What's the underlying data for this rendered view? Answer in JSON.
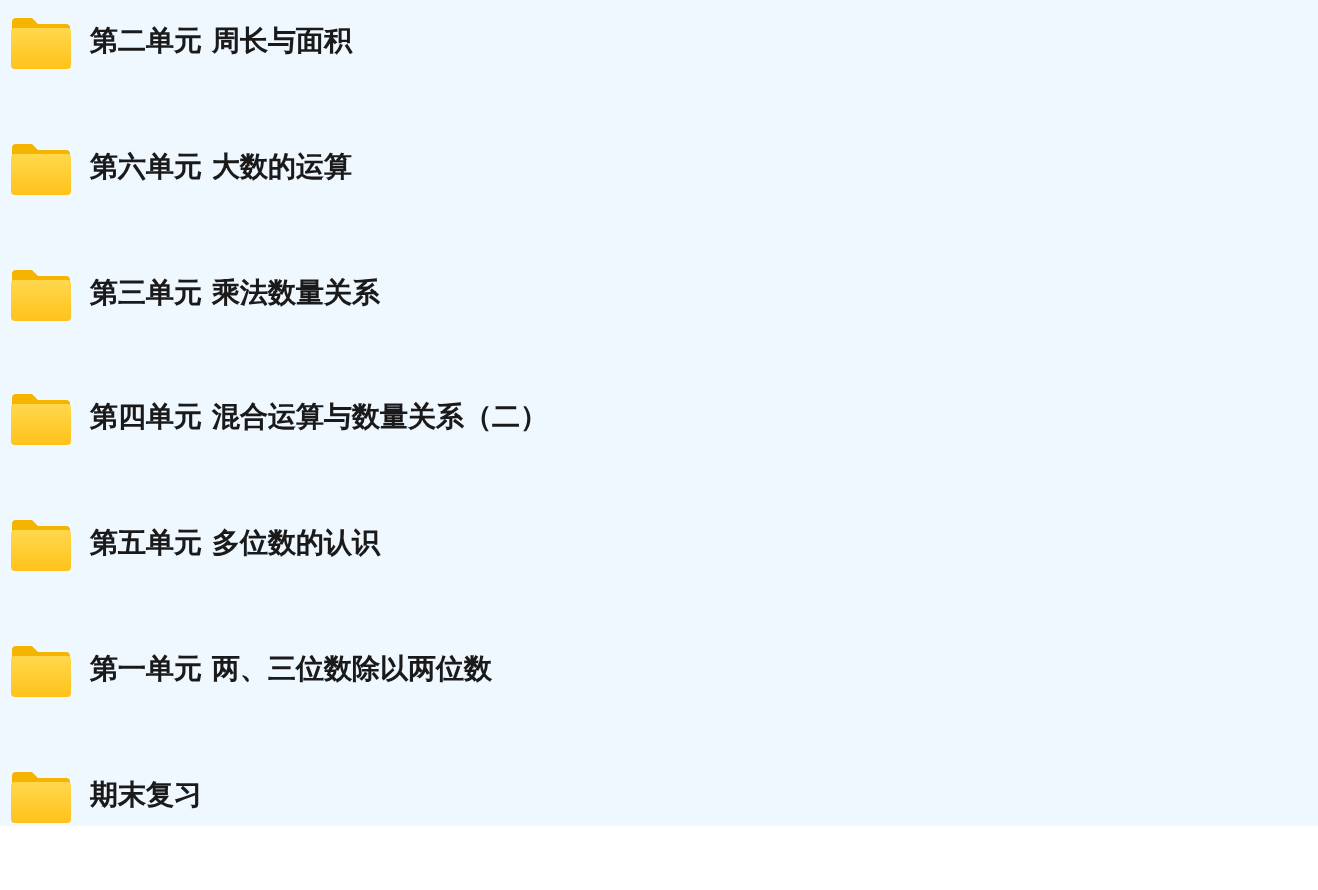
{
  "folders": [
    {
      "name": "第二单元 周长与面积"
    },
    {
      "name": "第六单元 大数的运算"
    },
    {
      "name": "第三单元 乘法数量关系"
    },
    {
      "name": "第四单元 混合运算与数量关系（二）"
    },
    {
      "name": "第五单元 多位数的认识"
    },
    {
      "name": "第一单元 两、三位数除以两位数"
    },
    {
      "name": "期末复习"
    }
  ]
}
